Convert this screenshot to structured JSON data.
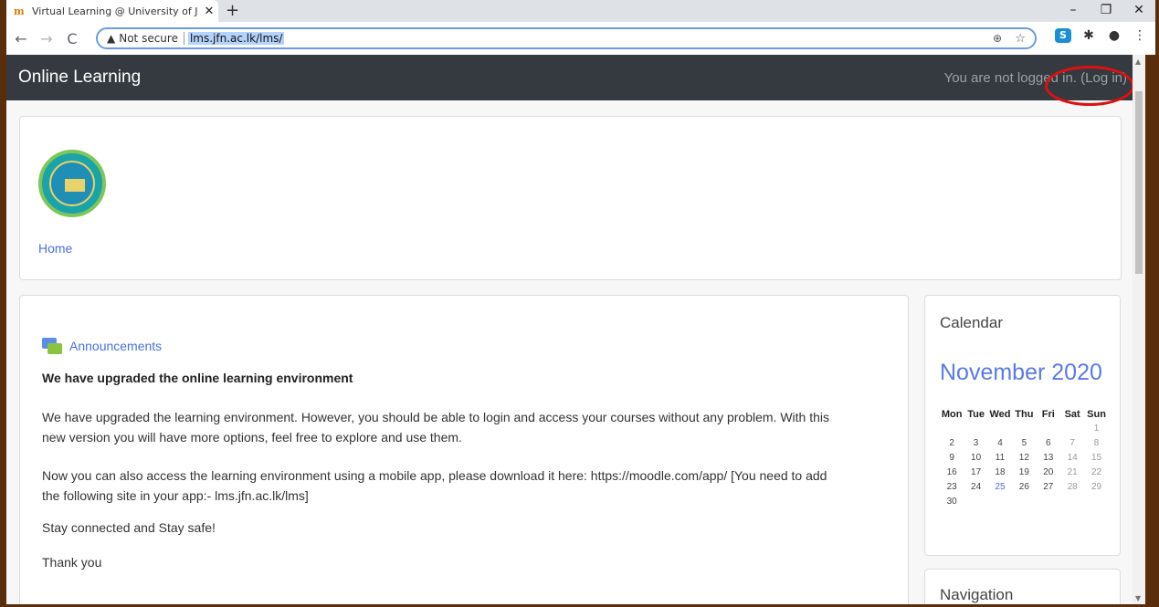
{
  "browser": {
    "tab_title": "Virtual Learning @ University of J",
    "tab_favicon": "moodle-favicon",
    "new_tab": "+",
    "security_label": "Not secure",
    "url": "lms.jfn.ac.lk/lms/",
    "window_controls": [
      "–",
      "❐",
      "✕"
    ]
  },
  "navbar": {
    "brand": "Online Learning",
    "login_text": "You are not logged in.",
    "login_link": "(Log in)",
    "highlight_color": "#e01010"
  },
  "header": {
    "home_link": "Home"
  },
  "main": {
    "forum_link": "Announcements",
    "post_title": "We have upgraded the online learning environment",
    "paragraphs": [
      "We have upgraded the learning environment. However, you should be able to login and access your courses without any problem. With this new version you will have more options, feel free to explore and use them.",
      "Now you can also access the learning environment using a mobile app, please download it here: https://moodle.com/app/ [You need to add the following site in your app:- lms.jfn.ac.lk/lms]",
      "Stay connected and Stay safe!",
      "Thank you"
    ]
  },
  "calendar": {
    "heading": "Calendar",
    "month": "November 2020",
    "weekdays": [
      "Mon",
      "Tue",
      "Wed",
      "Thu",
      "Fri",
      "Sat",
      "Sun"
    ],
    "weeks": [
      [
        "",
        "",
        "",
        "",
        "",
        "",
        "1"
      ],
      [
        "2",
        "3",
        "4",
        "5",
        "6",
        "7",
        "8"
      ],
      [
        "9",
        "10",
        "11",
        "12",
        "13",
        "14",
        "15"
      ],
      [
        "16",
        "17",
        "18",
        "19",
        "20",
        "21",
        "22"
      ],
      [
        "23",
        "24",
        "25",
        "26",
        "27",
        "28",
        "29"
      ],
      [
        "30",
        "",
        "",
        "",
        "",
        "",
        ""
      ]
    ],
    "today": "25",
    "accent_color": "#5a7ae8"
  },
  "navigation": {
    "heading": "Navigation"
  }
}
